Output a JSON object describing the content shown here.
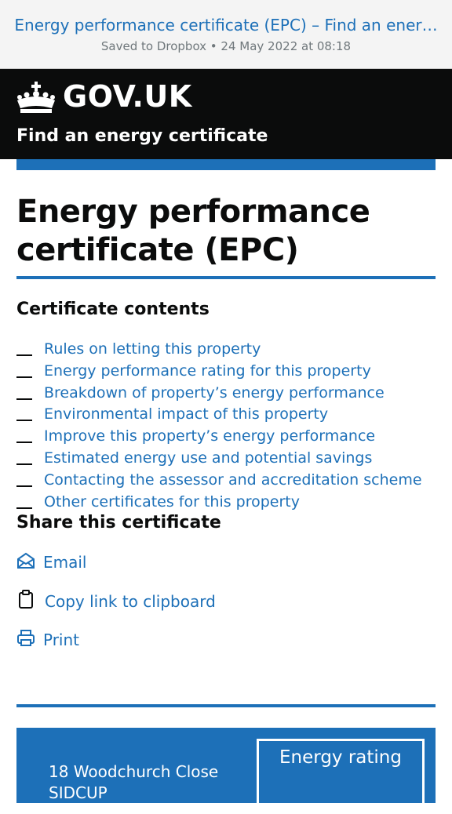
{
  "browser": {
    "page_title": "Energy performance certificate (EPC) – Find an ener…",
    "saved_info": "Saved to Dropbox • 24 May 2022 at 08:18"
  },
  "header": {
    "logo_text": "GOV.UK",
    "service_name": "Find an energy certificate"
  },
  "main": {
    "title": "Energy performance certificate (EPC)",
    "contents_heading": "Certificate contents",
    "contents": [
      "Rules on letting this property",
      "Energy performance rating for this property",
      "Breakdown of property’s energy performance",
      "Environmental impact of this property",
      "Improve this property’s energy performance",
      "Estimated energy use and potential savings",
      "Contacting the assessor and accreditation scheme",
      "Other certificates for this property"
    ],
    "share_heading": "Share this certificate",
    "share": {
      "email": "Email",
      "copy": "Copy link to clipboard",
      "print": "Print"
    }
  },
  "summary": {
    "address_line1": "18 Woodchurch Close",
    "address_line2": "SIDCUP",
    "rating_label": "Energy rating"
  },
  "colors": {
    "link": "#1d70b8",
    "header_bg": "#0b0c0c",
    "brand_blue": "#1d70b8"
  }
}
